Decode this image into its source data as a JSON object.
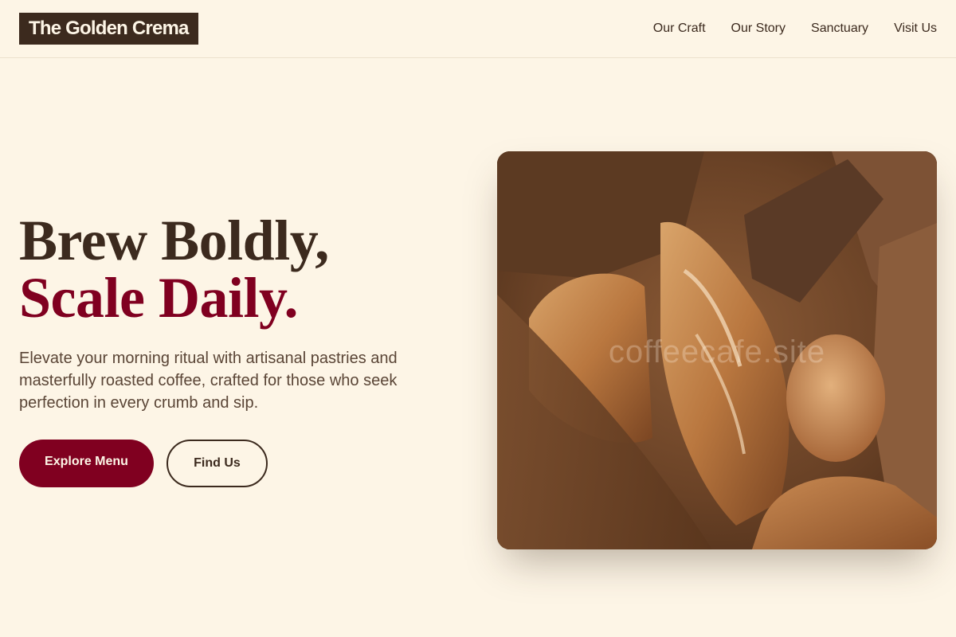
{
  "brand": {
    "name": "The Golden Crema"
  },
  "nav": {
    "items": [
      {
        "label": "Our Craft"
      },
      {
        "label": "Our Story"
      },
      {
        "label": "Sanctuary"
      },
      {
        "label": "Visit Us"
      }
    ]
  },
  "hero": {
    "headline_line1": "Brew Boldly,",
    "headline_line2": "Scale Daily.",
    "lead": "Elevate your morning ritual with artisanal pastries and masterfully roasted coffee, crafted for those who seek perfection in every crumb and sip.",
    "primary_cta": "Explore Menu",
    "secondary_cta": "Find Us",
    "image_watermark": "coffeecafe.site"
  },
  "colors": {
    "background": "#fdf5e6",
    "espresso": "#3c2a1e",
    "burgundy": "#800020"
  },
  "icons": {
    "hero_image": "bread-loaves-in-paper-bag-photo"
  }
}
